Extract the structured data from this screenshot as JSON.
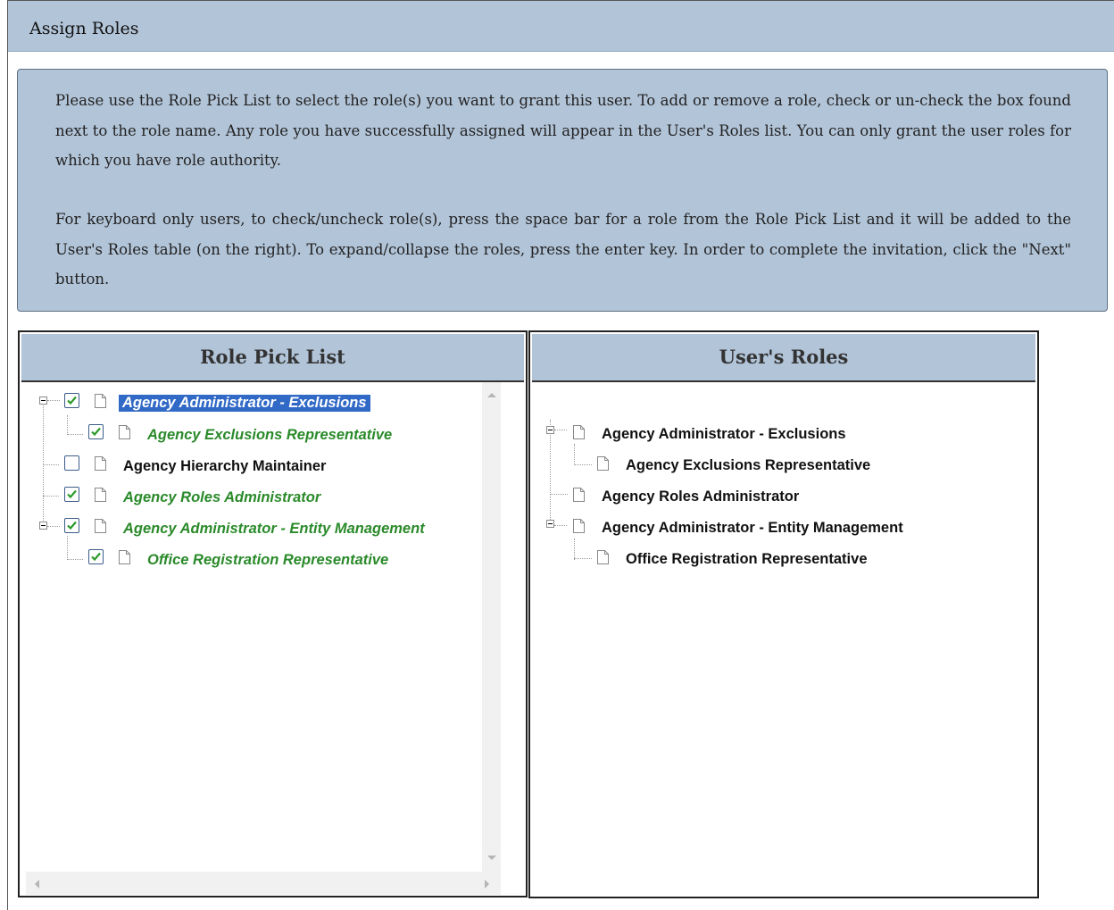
{
  "header": {
    "title": "Assign Roles"
  },
  "info": {
    "paragraph1": "Please use the Role Pick List to select the role(s) you want to grant this user. To add or remove a role, check or un-check the box found next to the role name. Any role you have successfully assigned will appear in the User's Roles list. You can only grant the user roles for which you have role authority.",
    "paragraph2": "For keyboard only users, to check/uncheck role(s), press the space bar for a role from the Role Pick List and it will be added to the User's Roles table (on the right). To expand/collapse the roles, press the enter key. In order to complete the invitation, click the \"Next\" button."
  },
  "pick_list": {
    "title": "Role Pick List",
    "items": [
      {
        "label": "Agency Administrator - Exclusions",
        "checked": true,
        "selected": true
      },
      {
        "label": "Agency Exclusions Representative",
        "checked": true
      },
      {
        "label": "Agency Hierarchy Maintainer",
        "checked": false
      },
      {
        "label": "Agency Roles Administrator",
        "checked": true
      },
      {
        "label": "Agency Administrator - Entity Management",
        "checked": true
      },
      {
        "label": "Office Registration Representative",
        "checked": true
      }
    ]
  },
  "user_roles": {
    "title": "User's Roles",
    "items": [
      {
        "label": "Agency Administrator - Exclusions"
      },
      {
        "label": "Agency Exclusions Representative"
      },
      {
        "label": "Agency Roles Administrator"
      },
      {
        "label": "Agency Administrator - Entity Management"
      },
      {
        "label": "Office Registration Representative"
      }
    ]
  },
  "icons": {
    "expander": "collapse-icon",
    "checkbox": "checkbox-icon",
    "document": "document-icon"
  },
  "colors": {
    "header_bg": "#b2c4d8",
    "assigned_green": "#2a8a2a",
    "selection_blue": "#3169c6"
  }
}
